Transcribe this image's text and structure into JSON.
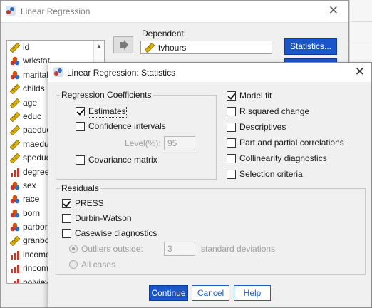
{
  "main_window": {
    "title": "Linear Regression",
    "dependent_label": "Dependent:",
    "dependent_value": "tvhours",
    "statistics_button": "Statistics...",
    "variables": [
      {
        "name": "id",
        "type": "scale"
      },
      {
        "name": "wrkstat",
        "type": "nominal"
      },
      {
        "name": "marital",
        "type": "nominal"
      },
      {
        "name": "childs",
        "type": "scale"
      },
      {
        "name": "age",
        "type": "scale"
      },
      {
        "name": "educ",
        "type": "scale"
      },
      {
        "name": "paeduc",
        "type": "scale"
      },
      {
        "name": "maeduc",
        "type": "scale"
      },
      {
        "name": "speduc",
        "type": "scale"
      },
      {
        "name": "degree",
        "type": "ordinal"
      },
      {
        "name": "sex",
        "type": "nominal"
      },
      {
        "name": "race",
        "type": "nominal"
      },
      {
        "name": "born",
        "type": "nominal"
      },
      {
        "name": "parborn",
        "type": "nominal"
      },
      {
        "name": "granborn",
        "type": "scale"
      },
      {
        "name": "income",
        "type": "ordinal"
      },
      {
        "name": "rincom",
        "type": "ordinal"
      },
      {
        "name": "polviews",
        "type": "ordinal"
      }
    ]
  },
  "dialog": {
    "title": "Linear Regression: Statistics",
    "coefficients": {
      "group_label": "Regression Coefficients",
      "estimates": {
        "label": "Estimates",
        "checked": true
      },
      "confidence_intervals": {
        "label": "Confidence intervals",
        "checked": false
      },
      "level_label": "Level(%):",
      "level_value": "95",
      "covariance": {
        "label": "Covariance matrix",
        "checked": false
      }
    },
    "right_options": [
      {
        "label": "Model fit",
        "checked": true
      },
      {
        "label": "R squared change",
        "checked": false
      },
      {
        "label": "Descriptives",
        "checked": false
      },
      {
        "label": "Part and partial correlations",
        "checked": false
      },
      {
        "label": "Collinearity diagnostics",
        "checked": false
      },
      {
        "label": "Selection criteria",
        "checked": false
      }
    ],
    "residuals": {
      "group_label": "Residuals",
      "press": {
        "label": "PRESS",
        "checked": true
      },
      "durbin_watson": {
        "label": "Durbin-Watson",
        "checked": false
      },
      "casewise": {
        "label": "Casewise diagnostics",
        "checked": false
      },
      "outliers_label": "Outliers outside:",
      "outliers_value": "3",
      "std_dev_label": "standard deviations",
      "all_cases_label": "All cases"
    },
    "buttons": {
      "continue": "Continue",
      "cancel": "Cancel",
      "help": "Help"
    }
  },
  "colors": {
    "accent": "#1a56c8",
    "disabled_text": "#a0a0a0"
  }
}
